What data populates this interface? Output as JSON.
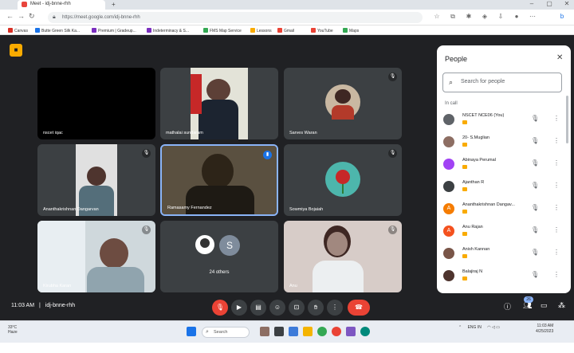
{
  "browser": {
    "tab_title": "Meet - idj-bnne-rhh",
    "url": "https://meet.google.com/idj-bnne-rhh",
    "bookmarks": [
      {
        "label": "Canvas",
        "color": "#d93025"
      },
      {
        "label": "Butte Green Silk Ka...",
        "color": "#1a73e8"
      },
      {
        "label": "Premium | Gradeup...",
        "color": "#7b2fbf"
      },
      {
        "label": "Indeterminacy & S...",
        "color": "#7b2fbf"
      },
      {
        "label": "FMS Map Service",
        "color": "#34a853"
      },
      {
        "label": "Lessons",
        "color": "#f9ab00"
      },
      {
        "label": "Gmail",
        "color": "#ea4335"
      },
      {
        "label": "YouTube",
        "color": "#ea4335"
      },
      {
        "label": "Maps",
        "color": "#34a853"
      }
    ]
  },
  "meeting": {
    "time": "11:03 AM",
    "separator": "|",
    "code": "idj-bnne-rhh",
    "participant_count_badge": "26"
  },
  "tiles": [
    {
      "name": "nscet iqac",
      "avatar": "black"
    },
    {
      "name": "mathalai sundaram",
      "avatar": "video"
    },
    {
      "name": "Sarves Waran",
      "avatar": "photo"
    },
    {
      "name": "Ananthakrishnan Dangarvan",
      "avatar": "video"
    },
    {
      "name": "Ramasamy Fernandez",
      "avatar": "video-active"
    },
    {
      "name": "Sowmiya Bojaiah",
      "avatar": "rose"
    },
    {
      "name": "Kirubha Karan",
      "avatar": "video"
    },
    {
      "name": "24 others",
      "avatar": "group",
      "group_letter": "S"
    },
    {
      "name": "Anu",
      "avatar": "video"
    }
  ],
  "people_panel": {
    "title": "People",
    "search_placeholder": "Search for people",
    "section_label": "In call",
    "participants": [
      {
        "name": "NSCET NCE06 (You)",
        "color": "#5f6368",
        "initial": ""
      },
      {
        "name": "20- S.Muglian",
        "color": "#8d6e63",
        "initial": ""
      },
      {
        "name": "Abinaya Perumal",
        "color": "#a142f4",
        "initial": ""
      },
      {
        "name": "Ajanthan R",
        "color": "#3c4043",
        "initial": ""
      },
      {
        "name": "Ananthakrishnan Dangav...",
        "color": "#f57c00",
        "initial": "A"
      },
      {
        "name": "Anu Rajan",
        "color": "#f4511e",
        "initial": "A"
      },
      {
        "name": "Anish Kannan",
        "color": "#795548",
        "initial": ""
      },
      {
        "name": "Balajiraj N",
        "color": "#4e342e",
        "initial": ""
      }
    ]
  },
  "taskbar": {
    "weather_temp": "33°C",
    "weather_desc": "Haze",
    "search_label": "Search",
    "lang": "ENG",
    "region": "IN",
    "clock_time": "11:03 AM",
    "clock_date": "4/25/2023"
  }
}
